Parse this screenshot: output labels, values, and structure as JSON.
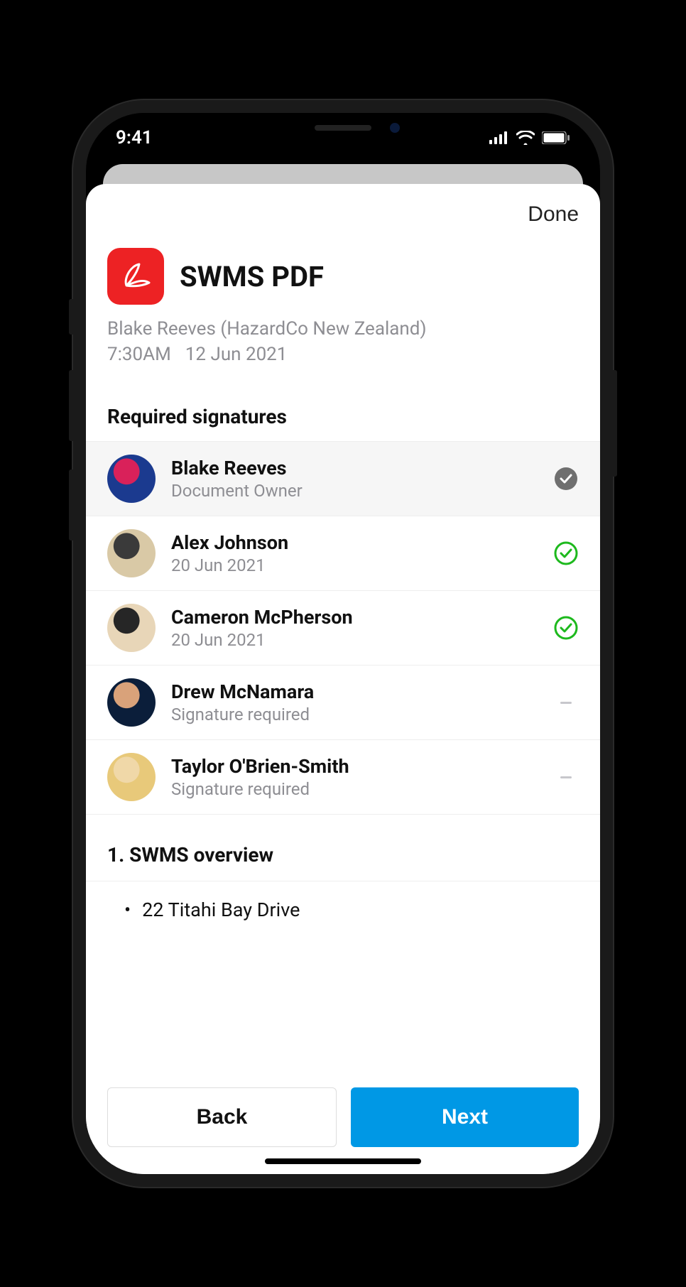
{
  "status": {
    "time": "9:41"
  },
  "sheet": {
    "done_label": "Done"
  },
  "doc": {
    "title": "SWMS PDF",
    "owner_line": "Blake Reeves (HazardCo New Zealand)",
    "time": "7:30AM",
    "date": "12 Jun 2021"
  },
  "signatures": {
    "section_title": "Required signatures",
    "items": [
      {
        "name": "Blake Reeves",
        "sub": "Document Owner",
        "status": "owner"
      },
      {
        "name": "Alex Johnson",
        "sub": "20 Jun 2021",
        "status": "signed"
      },
      {
        "name": "Cameron McPherson",
        "sub": "20 Jun 2021",
        "status": "signed"
      },
      {
        "name": "Drew McNamara",
        "sub": "Signature required",
        "status": "pending"
      },
      {
        "name": "Taylor O'Brien-Smith",
        "sub": "Signature required",
        "status": "pending"
      }
    ]
  },
  "overview": {
    "title": "1. SWMS overview",
    "items": [
      "22 Titahi Bay Drive"
    ]
  },
  "buttons": {
    "back": "Back",
    "next": "Next"
  },
  "avatar_colors": [
    [
      "#1b3a8f",
      "#d9215a"
    ],
    [
      "#d9c9a6",
      "#3a3a3a"
    ],
    [
      "#e8d6b8",
      "#262626"
    ],
    [
      "#0b1e3a",
      "#d9a27a"
    ],
    [
      "#e8c97a",
      "#f0d8a8"
    ]
  ]
}
